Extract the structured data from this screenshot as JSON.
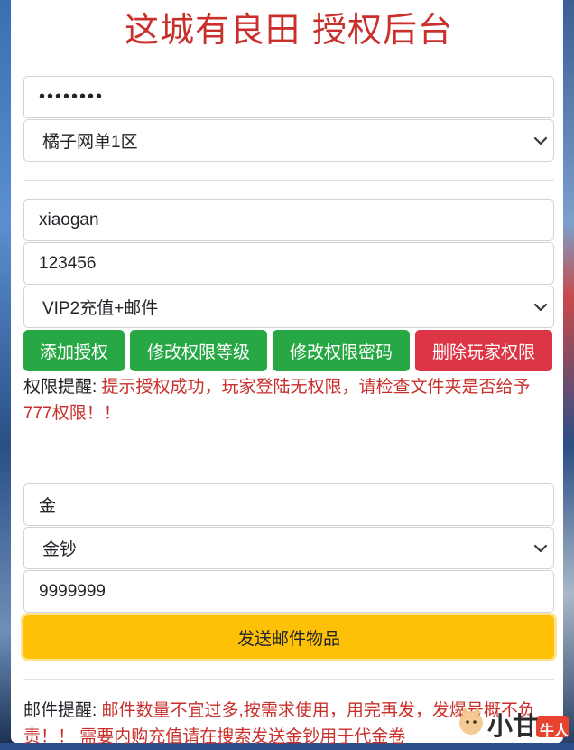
{
  "title": "这城有良田 授权后台",
  "login": {
    "password_value": "••••••••",
    "server_selected": "橘子网单1区"
  },
  "auth": {
    "username_value": "xiaogan",
    "user_password_value": "123456",
    "level_selected": "VIP2充值+邮件",
    "buttons": {
      "add": "添加授权",
      "modify_level": "修改权限等级",
      "modify_password": "修改权限密码",
      "delete": "删除玩家权限"
    },
    "notice_label": "权限提醒:",
    "notice_text": " 提示授权成功，玩家登陆无权限，请检查文件夹是否给予777权限！！"
  },
  "mail": {
    "search_value": "金",
    "item_selected": "金钞",
    "quantity_value": "9999999",
    "send_label": "发送邮件物品",
    "notice_label": "邮件提醒:",
    "notice_text": " 邮件数量不宜过多,按需求使用，用完再发，发爆号概不负责！！ 需要内购充值请在搜索发送金钞用于代金卷"
  },
  "watermark": {
    "text_main": "小甘",
    "text_badge": "牛人"
  },
  "colors": {
    "title": "#c9302c",
    "green": "#28a745",
    "red": "#dc3545",
    "yellow": "#ffc107"
  }
}
